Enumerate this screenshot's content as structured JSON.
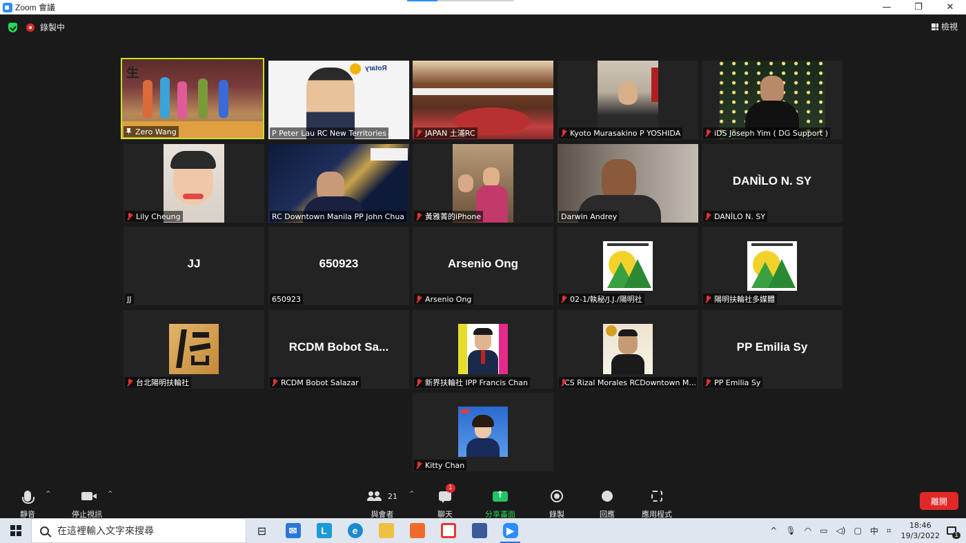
{
  "window": {
    "title": "Zoom 會議",
    "minimize": "—",
    "maximize": "❐",
    "close": "✕"
  },
  "meeting_top": {
    "recording_label": "錄製中",
    "view_label": "檢視"
  },
  "tiles": [
    {
      "name": "Zero Wang",
      "big": "",
      "state": "pinned",
      "active": true
    },
    {
      "name": "P Peter Lau RC New Territories",
      "big": "",
      "state": "none"
    },
    {
      "name": "JAPAN 土浦RC",
      "big": "",
      "state": "muted"
    },
    {
      "name": "Kyoto Murasakino P YOSHIDA",
      "big": "",
      "state": "muted"
    },
    {
      "name": "iDS Joseph Yim ( DG Support )",
      "big": "",
      "state": "muted"
    },
    {
      "name": "Lily Cheung",
      "big": "",
      "state": "muted"
    },
    {
      "name": "RC Downtown Manila PP John Chua",
      "big": "",
      "state": "none"
    },
    {
      "name": "黃雅菁的iPhone",
      "big": "",
      "state": "muted"
    },
    {
      "name": "Darwin Andrey",
      "big": "",
      "state": "none"
    },
    {
      "name": "DANÌLO N. SY",
      "big": "DANÌLO N. SY",
      "state": "muted"
    },
    {
      "name": "JJ",
      "big": "JJ",
      "state": "none"
    },
    {
      "name": "650923",
      "big": "650923",
      "state": "none"
    },
    {
      "name": "Arsenio Ong",
      "big": "Arsenio Ong",
      "state": "muted"
    },
    {
      "name": "02-1/執秘/J.J./陽明社",
      "big": "",
      "state": "muted"
    },
    {
      "name": "陽明扶輪社多媒體",
      "big": "",
      "state": "muted"
    },
    {
      "name": "台北陽明扶輪社",
      "big": "",
      "state": "muted"
    },
    {
      "name": "RCDM Bobot Salazar",
      "big": "RCDM Bobot Sa...",
      "state": "muted"
    },
    {
      "name": "新界扶輪社 IPP Francis Chan",
      "big": "",
      "state": "muted"
    },
    {
      "name": "CS Rizal Morales RCDowntown M...",
      "big": "",
      "state": "muted"
    },
    {
      "name": "PP Emilia Sy",
      "big": "PP Emilia Sy",
      "state": "muted"
    },
    {
      "name": "Kitty Chan",
      "big": "",
      "state": "muted"
    }
  ],
  "controls": {
    "mute": "靜音",
    "stop_video": "停止視訊",
    "participants": "與會者",
    "participants_count": "21",
    "chat": "聊天",
    "chat_badge": "1",
    "share": "分享畫面",
    "record": "錄製",
    "reactions": "回應",
    "apps": "應用程式",
    "leave": "離開"
  },
  "taskbar": {
    "search_placeholder": "在這裡輸入文字來搜尋",
    "ime": "中",
    "time": "18:46",
    "date": "19/3/2022",
    "notif_count": "1"
  },
  "colors": {
    "active_speaker": "#c4e32a",
    "leave": "#e02828",
    "share": "#23c468",
    "brand": "#2d8cff"
  }
}
